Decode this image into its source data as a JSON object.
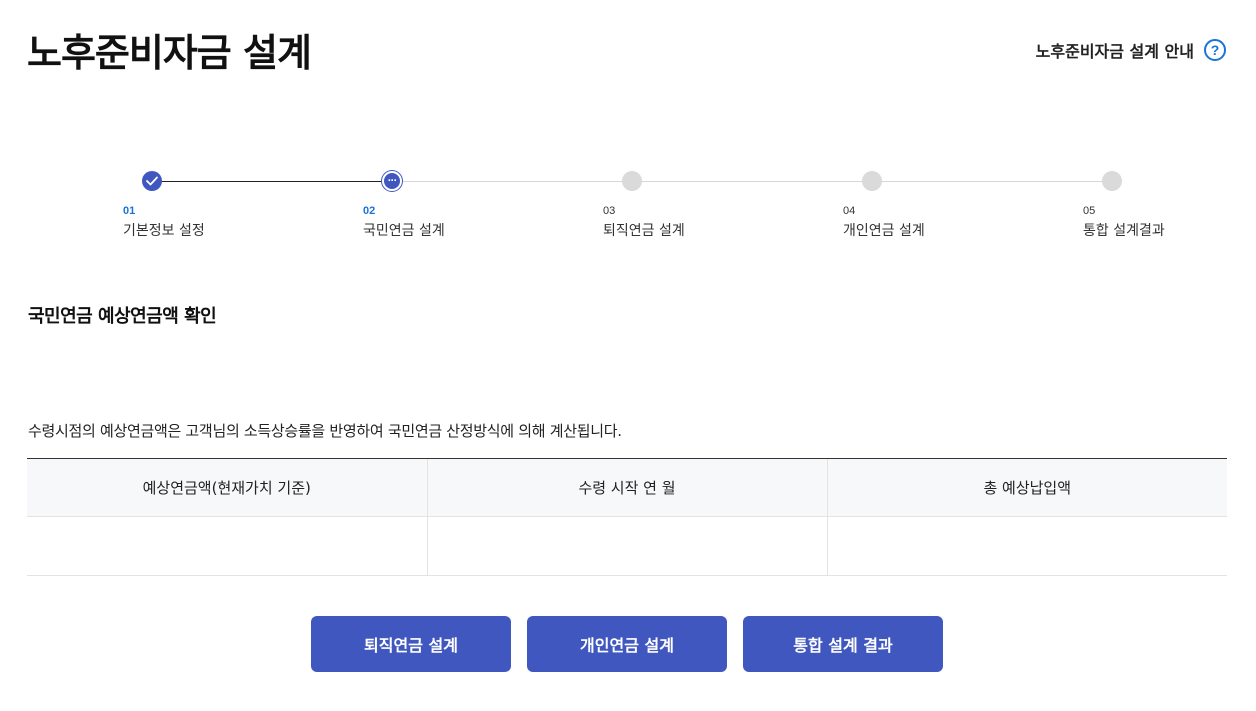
{
  "header": {
    "title": "노후준비자금 설계",
    "guide_label": "노후준비자금 설계 안내",
    "guide_icon": "help-circle-icon"
  },
  "stepper": {
    "steps": [
      {
        "num": "01",
        "label": "기본정보 설정",
        "state": "done"
      },
      {
        "num": "02",
        "label": "국민연금 설계",
        "state": "current"
      },
      {
        "num": "03",
        "label": "퇴직연금 설계",
        "state": "todo"
      },
      {
        "num": "04",
        "label": "개인연금 설계",
        "state": "todo"
      },
      {
        "num": "05",
        "label": "통합 설계결과",
        "state": "todo"
      }
    ]
  },
  "section": {
    "title": "국민연금 예상연금액 확인",
    "description": "수령시점의 예상연금액은 고객님의 소득상승률을 반영하여 국민연금 산정방식에 의해 계산됩니다."
  },
  "table": {
    "columns": [
      "예상연금액(현재가치 기준)",
      "수령 시작 연 월",
      "총 예상납입액"
    ],
    "rows": [
      [
        "",
        "",
        ""
      ]
    ]
  },
  "actions": {
    "retirement_label": "퇴직연금 설계",
    "personal_label": "개인연금 설계",
    "summary_label": "통합 설계 결과"
  },
  "colors": {
    "accent": "#3f57bf",
    "link_blue": "#1a73d9",
    "inactive_dot": "#dadada"
  }
}
